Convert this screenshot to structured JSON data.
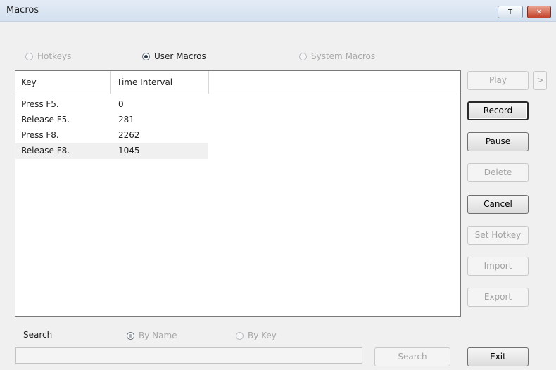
{
  "window": {
    "title": "Macros",
    "help_label": "T",
    "close_label": "✕"
  },
  "mode": {
    "options": [
      {
        "label": "Hotkeys",
        "selected": false,
        "enabled": false
      },
      {
        "label": "User Macros",
        "selected": true,
        "enabled": true
      },
      {
        "label": "System Macros",
        "selected": false,
        "enabled": false
      }
    ]
  },
  "macro_list": {
    "columns": [
      "Key",
      "Time Interval"
    ],
    "rows": [
      {
        "key": "Press F5.",
        "interval": "0"
      },
      {
        "key": "Release F5.",
        "interval": "281"
      },
      {
        "key": "Press F8.",
        "interval": "2262"
      },
      {
        "key": "Release F8.",
        "interval": "1045"
      }
    ]
  },
  "actions": {
    "play": "Play",
    "play_more": ">",
    "record": "Record",
    "pause": "Pause",
    "delete": "Delete",
    "cancel": "Cancel",
    "set_hotkey": "Set Hotkey",
    "import": "Import",
    "export": "Export"
  },
  "search": {
    "label": "Search",
    "by_name": "By Name",
    "by_key": "By Key",
    "button": "Search",
    "value": ""
  },
  "exit": "Exit"
}
